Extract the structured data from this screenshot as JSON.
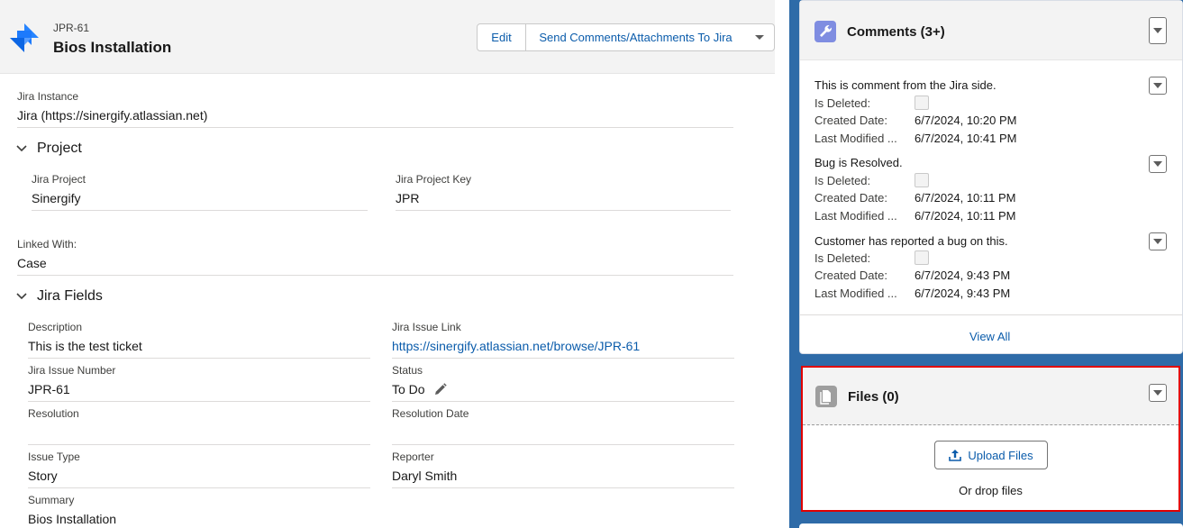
{
  "record": {
    "key": "JPR-61",
    "title": "Bios Installation",
    "edit_label": "Edit",
    "send_label": "Send Comments/Attachments To Jira"
  },
  "fields": {
    "jira_instance_label": "Jira Instance",
    "jira_instance_value": "Jira (https://sinergify.atlassian.net)",
    "project_section": "Project",
    "jira_project_label": "Jira Project",
    "jira_project_value": "Sinergify",
    "jira_project_key_label": "Jira Project Key",
    "jira_project_key_value": "JPR",
    "linked_with_label": "Linked With:",
    "linked_with_value": "Case",
    "jira_fields_section": "Jira Fields",
    "description_label": "Description",
    "description_value": "This is the test ticket",
    "issue_link_label": "Jira Issue Link",
    "issue_link_value": "https://sinergify.atlassian.net/browse/JPR-61",
    "issue_number_label": "Jira Issue Number",
    "issue_number_value": "JPR-61",
    "status_label": "Status",
    "status_value": "To Do",
    "resolution_label": "Resolution",
    "resolution_date_label": "Resolution Date",
    "issue_type_label": "Issue Type",
    "issue_type_value": "Story",
    "reporter_label": "Reporter",
    "reporter_value": "Daryl Smith",
    "summary_label": "Summary",
    "summary_value": "Bios Installation"
  },
  "comments": {
    "title": "Comments (3+)",
    "is_deleted_label": "Is Deleted:",
    "created_label": "Created Date:",
    "modified_label": "Last Modified ...",
    "items": [
      {
        "text": "This is comment from the Jira side.",
        "created": "6/7/2024, 10:20 PM",
        "modified": "6/7/2024, 10:41 PM"
      },
      {
        "text": "Bug is Resolved.",
        "created": "6/7/2024, 10:11 PM",
        "modified": "6/7/2024, 10:11 PM"
      },
      {
        "text": "Customer has reported a bug on this.",
        "created": "6/7/2024, 9:43 PM",
        "modified": "6/7/2024, 9:43 PM"
      }
    ],
    "view_all": "View All"
  },
  "files": {
    "title": "Files (0)",
    "upload_label": "Upload Files",
    "drop_text": "Or drop files"
  },
  "colors": {
    "brand_blue": "#0b5cab",
    "background": "#2e6ba8",
    "highlight_border": "#e00000",
    "comments_icon": "#7f8de1",
    "files_icon": "#9e9e9e"
  }
}
